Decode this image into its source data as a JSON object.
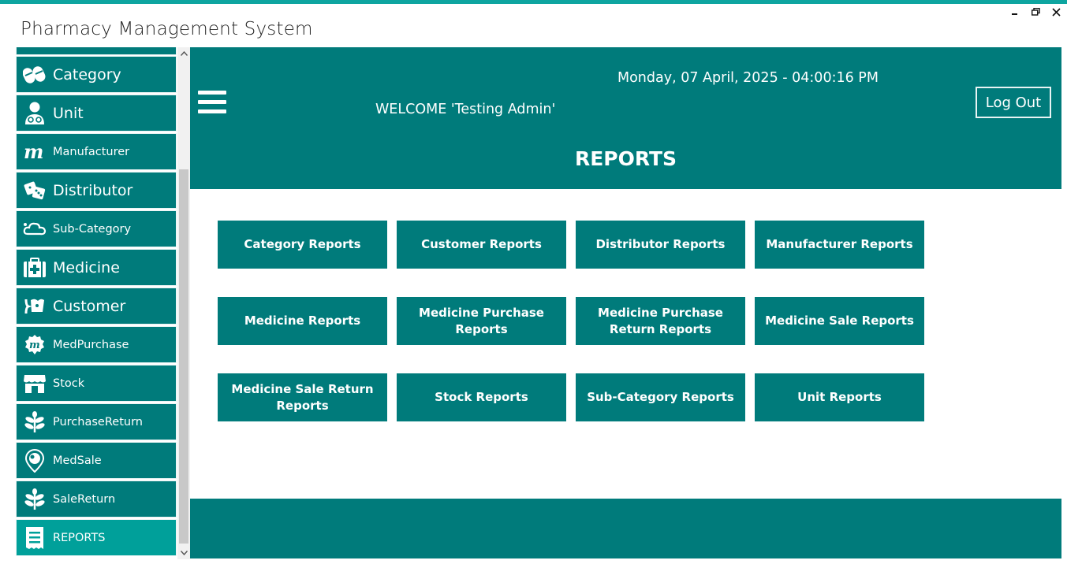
{
  "app": {
    "title": "Pharmacy Management System"
  },
  "window_controls": {
    "minimize": "–",
    "restore": "🗗",
    "close": "✕"
  },
  "sidebar": {
    "items": [
      {
        "label": "Category",
        "icon": "pills-icon"
      },
      {
        "label": "Unit",
        "icon": "doctor-icon"
      },
      {
        "label": "Manufacturer",
        "icon": "m-logo-icon"
      },
      {
        "label": "Distributor",
        "icon": "dice-icon"
      },
      {
        "label": "Sub-Category",
        "icon": "cloud-icon"
      },
      {
        "label": "Medicine",
        "icon": "medkit-icon"
      },
      {
        "label": "Customer",
        "icon": "bandage-icon"
      },
      {
        "label": "MedPurchase",
        "icon": "purchase-badge-icon"
      },
      {
        "label": "Stock",
        "icon": "store-icon"
      },
      {
        "label": "PurchaseReturn",
        "icon": "herb-icon"
      },
      {
        "label": "MedSale",
        "icon": "location-icon"
      },
      {
        "label": "SaleReturn",
        "icon": "herb-icon"
      },
      {
        "label": "REPORTS",
        "icon": "receipt-icon",
        "active": true
      }
    ]
  },
  "header": {
    "datetime": "Monday, 07 April, 2025 - 04:00:16 PM",
    "welcome": "WELCOME 'Testing Admin'",
    "logout_label": "Log Out",
    "page_title": "REPORTS"
  },
  "reports": [
    "Category Reports",
    "Customer Reports",
    "Distributor Reports",
    "Manufacturer Reports",
    "Medicine Reports",
    "Medicine Purchase Reports",
    "Medicine Purchase Return Reports",
    "Medicine Sale Reports",
    "Medicine Sale Return Reports",
    "Stock Reports",
    "Sub-Category Reports",
    "Unit Reports"
  ],
  "colors": {
    "primary": "#007b7b",
    "active": "#00a09a",
    "accent": "#0ea5a0"
  }
}
